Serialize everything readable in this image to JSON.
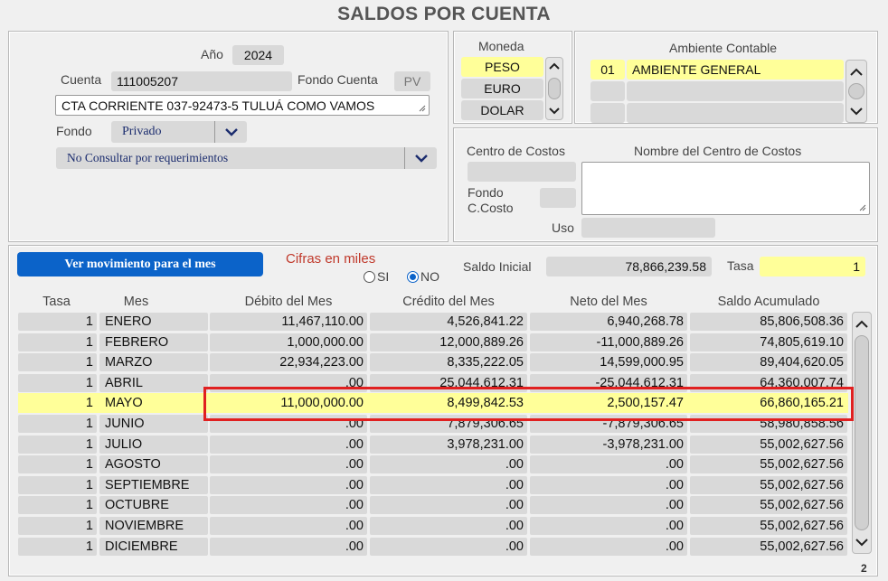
{
  "title": "SALDOS POR CUENTA",
  "account": {
    "anio_label": "Año",
    "anio_value": "2024",
    "cuenta_label": "Cuenta",
    "cuenta_value": "111005207",
    "fondo_cuenta_label": "Fondo Cuenta",
    "fondo_cuenta_value": "PV",
    "description": "CTA CORRIENTE 037-92473-5 TULUÁ COMO VAMOS",
    "fondo_label": "Fondo",
    "fondo_value": "Privado",
    "requerimientos_value": "No Consultar por requerimientos"
  },
  "moneda": {
    "label": "Moneda",
    "options": [
      "PESO",
      "EURO",
      "DOLAR"
    ],
    "selected": "PESO"
  },
  "ambiente": {
    "label": "Ambiente Contable",
    "rows": [
      {
        "code": "01",
        "name": "AMBIENTE GENERAL"
      },
      {
        "code": "",
        "name": ""
      },
      {
        "code": "",
        "name": ""
      }
    ]
  },
  "centro": {
    "centro_label": "Centro de Costos",
    "nombre_label": "Nombre del Centro de Costos",
    "fondo_ccosto_label_1": "Fondo",
    "fondo_ccosto_label_2": "C.Costo",
    "uso_label": "Uso",
    "centro_value": "",
    "fondo_value": "",
    "uso_value": "",
    "nombre_value": ""
  },
  "controls": {
    "ver_movimiento_label": "Ver movimiento para el mes",
    "cifras_label": "Cifras en miles",
    "si_label": "SI",
    "no_label": "NO",
    "cifras_selected": "NO",
    "saldo_inicial_label": "Saldo Inicial",
    "saldo_inicial_value": "78,866,239.58",
    "tasa_label": "Tasa",
    "tasa_value": "1"
  },
  "table": {
    "headers": [
      "Tasa",
      "Mes",
      "Débito del Mes",
      "Crédito del Mes",
      "Neto del Mes",
      "Saldo Acumulado"
    ],
    "selected_month": "MAYO",
    "rows": [
      {
        "tasa": "1",
        "mes": "ENERO",
        "debito": "11,467,110.00",
        "credito": "4,526,841.22",
        "neto": "6,940,268.78",
        "saldo": "85,806,508.36"
      },
      {
        "tasa": "1",
        "mes": "FEBRERO",
        "debito": "1,000,000.00",
        "credito": "12,000,889.26",
        "neto": "-11,000,889.26",
        "saldo": "74,805,619.10"
      },
      {
        "tasa": "1",
        "mes": "MARZO",
        "debito": "22,934,223.00",
        "credito": "8,335,222.05",
        "neto": "14,599,000.95",
        "saldo": "89,404,620.05"
      },
      {
        "tasa": "1",
        "mes": "ABRIL",
        "debito": ".00",
        "credito": "25,044,612.31",
        "neto": "-25,044,612.31",
        "saldo": "64,360,007.74"
      },
      {
        "tasa": "1",
        "mes": "MAYO",
        "debito": "11,000,000.00",
        "credito": "8,499,842.53",
        "neto": "2,500,157.47",
        "saldo": "66,860,165.21"
      },
      {
        "tasa": "1",
        "mes": "JUNIO",
        "debito": ".00",
        "credito": "7,879,306.65",
        "neto": "-7,879,306.65",
        "saldo": "58,980,858.56"
      },
      {
        "tasa": "1",
        "mes": "JULIO",
        "debito": ".00",
        "credito": "3,978,231.00",
        "neto": "-3,978,231.00",
        "saldo": "55,002,627.56"
      },
      {
        "tasa": "1",
        "mes": "AGOSTO",
        "debito": ".00",
        "credito": ".00",
        "neto": ".00",
        "saldo": "55,002,627.56"
      },
      {
        "tasa": "1",
        "mes": "SEPTIEMBRE",
        "debito": ".00",
        "credito": ".00",
        "neto": ".00",
        "saldo": "55,002,627.56"
      },
      {
        "tasa": "1",
        "mes": "OCTUBRE",
        "debito": ".00",
        "credito": ".00",
        "neto": ".00",
        "saldo": "55,002,627.56"
      },
      {
        "tasa": "1",
        "mes": "NOVIEMBRE",
        "debito": ".00",
        "credito": ".00",
        "neto": ".00",
        "saldo": "55,002,627.56"
      },
      {
        "tasa": "1",
        "mes": "DICIEMBRE",
        "debito": ".00",
        "credito": ".00",
        "neto": ".00",
        "saldo": "55,002,627.56"
      }
    ]
  },
  "page_number": "2",
  "colors": {
    "accent_blue": "#0b63c9",
    "highlight_yellow": "#ffff99",
    "emphasis_red": "#e02020",
    "label_red": "#c0392b"
  }
}
